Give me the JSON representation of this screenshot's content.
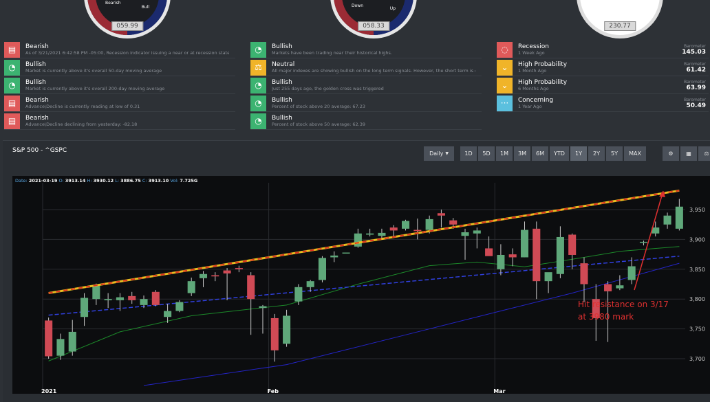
{
  "gauges": [
    {
      "left_label": "Bearish",
      "right_label": "Bull",
      "value": "059.99"
    },
    {
      "left_label": "Down",
      "right_label": "Up",
      "value": "058.33"
    },
    {
      "left_label": "",
      "right_label": "",
      "value": "230.77"
    }
  ],
  "signals_col1": [
    {
      "title": "Bearish",
      "desc": "As of 3/21/2021 6:42:58 PM -05:00, Recession indicator issuing a near or at recession state.",
      "color": "#e05a5a",
      "icon": "chat-icon"
    },
    {
      "title": "Bullish",
      "desc": "Market is currently above it's overall 50-day moving average",
      "color": "#3cb371",
      "icon": "gauge-icon"
    },
    {
      "title": "Bullish",
      "desc": "Market is currently above it's overall 200-day moving average",
      "color": "#3cb371",
      "icon": "gauge-icon"
    },
    {
      "title": "Bearish",
      "desc": "Advance\\Decline is currently reading at low of 0.31",
      "color": "#e05a5a",
      "icon": "chat-icon"
    },
    {
      "title": "Bearish",
      "desc": "Advance\\Decline declining from yesterday: -82.18",
      "color": "#e05a5a",
      "icon": "chat-icon"
    }
  ],
  "signals_col2": [
    {
      "title": "Bullish",
      "desc": "Markets have been trading near their historical highs.",
      "color": "#3cb371",
      "icon": "gauge-icon"
    },
    {
      "title": "Neutral",
      "desc": "All major indexes are showing bullish on the long term signals. However, the short term is cur...",
      "color": "#f0b429",
      "icon": "scale-icon"
    },
    {
      "title": "Bullish",
      "desc": "Just 255 days ago, the golden cross was triggered",
      "color": "#3cb371",
      "icon": "gauge-icon"
    },
    {
      "title": "Bullish",
      "desc": "Percent of stock above 20 average: 67.23",
      "color": "#3cb371",
      "icon": "gauge-icon"
    },
    {
      "title": "Bullish",
      "desc": "Percent of stock above 50 average: 62.39",
      "color": "#3cb371",
      "icon": "gauge-icon"
    }
  ],
  "signals_col3": [
    {
      "title": "Recession",
      "desc": "1 Week Ago",
      "color": "#e05a5a",
      "icon": "comment-icon",
      "bar_label": "Barometer",
      "bar_value": "145.03"
    },
    {
      "title": "High Probability",
      "desc": "1 Month Ago",
      "color": "#f0b429",
      "icon": "chevron-down-icon",
      "bar_label": "Barometer",
      "bar_value": "61.42"
    },
    {
      "title": "High Probability",
      "desc": "6 Months Ago",
      "color": "#f0b429",
      "icon": "chevron-down-icon",
      "bar_label": "Barometer",
      "bar_value": "63.99"
    },
    {
      "title": "Concerning",
      "desc": "1 Year Ago",
      "color": "#5bc0de",
      "icon": "ellipsis-icon",
      "bar_label": "Barometer",
      "bar_value": "50.49"
    }
  ],
  "chart_panel": {
    "title": "S&P 500 - ^GSPC",
    "interval": "Daily",
    "ranges": [
      "1D",
      "5D",
      "1M",
      "3M",
      "6M",
      "YTD",
      "1Y",
      "2Y",
      "5Y",
      "MAX"
    ]
  },
  "ohlc": {
    "date_label": "Date:",
    "date": "2021-03-19",
    "o_label": "O:",
    "o": "3913.14",
    "h_label": "H:",
    "h": "3930.12",
    "l_label": "L:",
    "l": "3886.75",
    "c_label": "C:",
    "c": "3913.10",
    "vol_label": "Vol:",
    "vol": "7.725G"
  },
  "annotation": [
    "Hit resistance on 3/17",
    "at 3980 mark"
  ],
  "chart_data": {
    "type": "candlestick",
    "x_ticks": [
      "2021",
      "Feb",
      "Mar"
    ],
    "y_ticks": [
      3700,
      3750,
      3800,
      3850,
      3900,
      3950
    ],
    "ylim": [
      3655,
      3995
    ],
    "n": 54,
    "candles": [
      [
        3764,
        3769,
        3700,
        3704
      ],
      [
        3705,
        3742,
        3698,
        3733
      ],
      [
        3712,
        3765,
        3705,
        3745
      ],
      [
        3770,
        3810,
        3755,
        3802
      ],
      [
        3800,
        3826,
        3790,
        3822
      ],
      [
        3798,
        3810,
        3785,
        3800
      ],
      [
        3798,
        3810,
        3780,
        3803
      ],
      [
        3805,
        3812,
        3792,
        3798
      ],
      [
        3790,
        3806,
        3785,
        3800
      ],
      [
        3812,
        3815,
        3788,
        3790
      ],
      [
        3770,
        3792,
        3760,
        3780
      ],
      [
        3780,
        3798,
        3778,
        3795
      ],
      [
        3810,
        3836,
        3805,
        3830
      ],
      [
        3835,
        3847,
        3820,
        3842
      ],
      [
        3840,
        3845,
        3830,
        3838
      ],
      [
        3848,
        3852,
        3798,
        3843
      ],
      [
        3852,
        3856,
        3845,
        3850
      ],
      [
        3840,
        3845,
        3740,
        3800
      ],
      [
        3785,
        3790,
        3742,
        3788
      ],
      [
        3768,
        3775,
        3695,
        3714
      ],
      [
        3725,
        3782,
        3720,
        3772
      ],
      [
        3796,
        3825,
        3790,
        3820
      ],
      [
        3820,
        3832,
        3812,
        3830
      ],
      [
        3832,
        3872,
        3828,
        3869
      ],
      [
        3870,
        3880,
        3862,
        3873
      ],
      [
        3878,
        3880,
        3880,
        3878
      ],
      [
        3888,
        3918,
        3886,
        3910
      ],
      [
        3908,
        3918,
        3905,
        3910
      ],
      [
        3906,
        3918,
        3902,
        3911
      ],
      [
        3920,
        3924,
        3905,
        3915
      ],
      [
        3918,
        3933,
        3915,
        3931
      ],
      [
        3916,
        3935,
        3900,
        3914
      ],
      [
        3916,
        3940,
        3910,
        3934
      ],
      [
        3944,
        3950,
        3920,
        3940
      ],
      [
        3932,
        3936,
        3918,
        3925
      ],
      [
        3906,
        3918,
        3866,
        3912
      ],
      [
        3910,
        3920,
        3885,
        3915
      ],
      [
        3885,
        3905,
        3878,
        3872
      ],
      [
        3850,
        3892,
        3840,
        3874
      ],
      [
        3875,
        3885,
        3855,
        3870
      ],
      [
        3870,
        3930,
        3870,
        3916
      ],
      [
        3918,
        3930,
        3800,
        3830
      ],
      [
        3830,
        3842,
        3810,
        3845
      ],
      [
        3842,
        3922,
        3835,
        3904
      ],
      [
        3908,
        3910,
        3850,
        3874
      ],
      [
        3860,
        3870,
        3795,
        3825
      ],
      [
        3800,
        3825,
        3730,
        3768
      ],
      [
        3825,
        3830,
        3728,
        3813
      ],
      [
        3818,
        3840,
        3815,
        3823
      ],
      [
        3832,
        3870,
        3825,
        3855
      ],
      [
        3895,
        3898,
        3890,
        3896
      ],
      [
        3910,
        3930,
        3905,
        3920
      ],
      [
        3925,
        3945,
        3918,
        3940
      ],
      [
        3918,
        3968,
        3915,
        3955
      ]
    ],
    "resistance_line": [
      [
        0,
        3810
      ],
      [
        53,
        3982
      ]
    ],
    "ma_blue": [
      [
        0,
        3773
      ],
      [
        53,
        3872
      ]
    ],
    "ma_green": [
      [
        0,
        3696
      ],
      [
        6,
        3745
      ],
      [
        12,
        3772
      ],
      [
        20,
        3790
      ],
      [
        26,
        3825
      ],
      [
        32,
        3856
      ],
      [
        36,
        3862
      ],
      [
        40,
        3854
      ],
      [
        45,
        3870
      ],
      [
        48,
        3880
      ],
      [
        53,
        3888
      ]
    ],
    "ma_darkblue": [
      [
        8,
        3655
      ],
      [
        20,
        3690
      ],
      [
        30,
        3740
      ],
      [
        38,
        3780
      ],
      [
        44,
        3810
      ],
      [
        53,
        3860
      ]
    ]
  }
}
